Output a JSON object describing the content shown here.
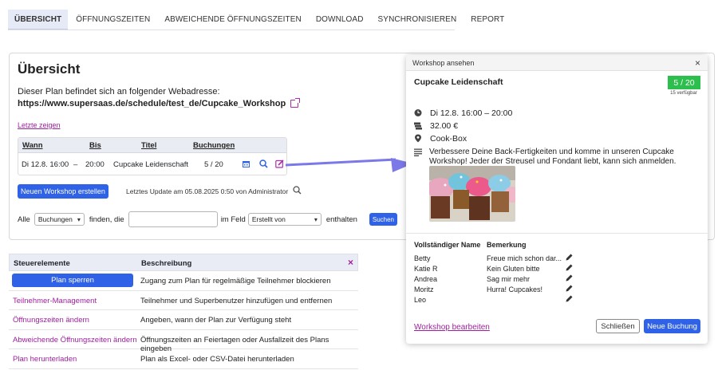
{
  "tabs": [
    {
      "label": "ÜBERSICHT",
      "active": true
    },
    {
      "label": "ÖFFNUNGSZEITEN"
    },
    {
      "label": "ABWEICHENDE ÖFFNUNGSZEITEN"
    },
    {
      "label": "DOWNLOAD"
    },
    {
      "label": "SYNCHRONISIEREN"
    },
    {
      "label": "REPORT"
    }
  ],
  "overview": {
    "title": "Übersicht",
    "plan_text": "Dieser Plan befindet sich an folgender Webadresse:",
    "plan_url": "https://www.supersaas.de/schedule/test_de/Cupcake_Workshop",
    "show_last": "Letzte zeigen",
    "table": {
      "headers": [
        "Wann",
        "Bis",
        "Titel",
        "Buchungen"
      ],
      "row": {
        "wann": "Di 12.8. 16:00",
        "dash": "–",
        "bis": "20:00",
        "titel": "Cupcake Leidenschaft",
        "buchungen": "5 / 20"
      }
    },
    "new_workshop_button": "Neuen Workshop erstellen",
    "last_update": "Letztes Update am 05.08.2025 0:50 von Administrator",
    "filter": {
      "all_label": "Alle",
      "type_select": "Buchungen",
      "find_label": "finden, die",
      "search_value": "",
      "field_label": "im Feld",
      "field_select": "Erstellt von",
      "contains_label": "enthalten",
      "search_button": "Suchen"
    }
  },
  "controls": {
    "headers": [
      "Steuerelemente",
      "Beschreibung"
    ],
    "rows": [
      {
        "control": "Plan sperren",
        "description": "Zugang zum Plan für regelmäßige Teilnehmer blockieren"
      },
      {
        "control": "Teilnehmer-Management",
        "description": "Teilnehmer und Superbenutzer hinzufügen und entfernen"
      },
      {
        "control": "Öffnungszeiten ändern",
        "description": "Angeben, wann der Plan zur Verfügung steht"
      },
      {
        "control": "Abweichende Öffnungszeiten ändern",
        "description": "Öffnungszeiten an Feiertagen oder Ausfallzeit des Plans eingeben"
      },
      {
        "control": "Plan herunterladen",
        "description": "Plan als Excel- oder CSV-Datei herunterladen"
      }
    ]
  },
  "popup": {
    "header": "Workshop ansehen",
    "close": "×",
    "title": "Cupcake Leidenschaft",
    "badge": "5 / 20",
    "available": "15 verfügbar",
    "datetime": "Di 12.8.  16:00 – 20:00",
    "price": "32.00 €",
    "location": "Cook-Box",
    "description": "Verbessere Deine Back-Fertigkeiten und komme in unseren Cupcake Workshop! Jeder der Streusel und Fondant liebt, kann sich anmelden.",
    "participant_headers": [
      "Vollständiger Name",
      "Bemerkung"
    ],
    "participants": [
      {
        "name": "Betty",
        "remark": "Freue mich schon dar..."
      },
      {
        "name": "Katie R",
        "remark": "Kein Gluten bitte"
      },
      {
        "name": "Andrea",
        "remark": "Sag mir mehr"
      },
      {
        "name": "Moritz",
        "remark": "Hurra! Cupcakes!"
      },
      {
        "name": "Leo",
        "remark": ""
      }
    ],
    "edit_link": "Workshop bearbeiten",
    "close_button": "Schließen",
    "new_booking_button": "Neue Buchung"
  },
  "colors": {
    "accent": "#2f62e6",
    "link": "#a020a0",
    "badge": "#2dbf4e",
    "arrow": "#7b78e8"
  }
}
